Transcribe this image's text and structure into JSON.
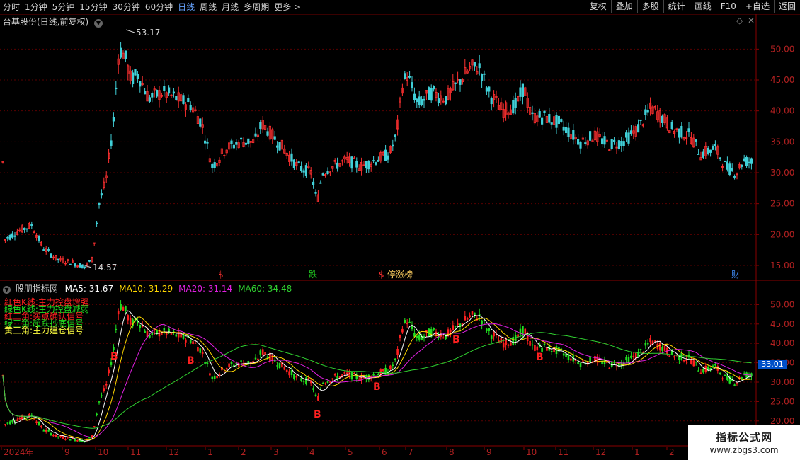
{
  "toolbar": {
    "periods": [
      "分时",
      "1分钟",
      "5分钟",
      "15分钟",
      "30分钟",
      "60分钟",
      "日线",
      "周线",
      "月线",
      "多周期",
      "更多 >"
    ],
    "active_period": "日线",
    "buttons": [
      "复权",
      "叠加",
      "多股",
      "统计",
      "画线",
      "F10",
      "+自选",
      "返回"
    ]
  },
  "top_chart": {
    "title": "台基股份(日线,前复权)",
    "y_ticks": [
      "50.00",
      "45.00",
      "40.00",
      "35.00",
      "30.00",
      "25.00",
      "20.00",
      "15.00"
    ],
    "high_label": "53.17",
    "low_label": "14.57",
    "events": [
      {
        "text": "$",
        "color": "#ff3030"
      },
      {
        "text": "跌",
        "color": "#20d020"
      },
      {
        "text": "$",
        "color": "#ff3030"
      },
      {
        "text": "停涨榜",
        "color": "#ffd060"
      },
      {
        "text": "财",
        "color": "#4090ff"
      }
    ],
    "colors": {
      "up": "#ff3030",
      "down": "#40d0d8"
    }
  },
  "bottom_chart": {
    "title": "股朋指标网",
    "ma": [
      {
        "label": "MA5: 31.67",
        "color": "#ffffff"
      },
      {
        "label": "MA10: 31.29",
        "color": "#ffd700"
      },
      {
        "label": "MA20: 31.14",
        "color": "#e020e0"
      },
      {
        "label": "MA60: 34.48",
        "color": "#30d030"
      }
    ],
    "legend": [
      {
        "text": "红色K线:主力控盘增强",
        "color": "#ff2020"
      },
      {
        "text": "绿色K线:主力控盘减弱",
        "color": "#20e020"
      },
      {
        "text": "红三角:买点确认信号",
        "color": "#ff2020"
      },
      {
        "text": "绿三角:超跌抄底信号",
        "color": "#20e020"
      },
      {
        "text": "黄三角:主力建仓信号",
        "color": "#ffff40"
      }
    ],
    "y_ticks": [
      "50.00",
      "45.00",
      "40.00",
      "35.00",
      "30.00",
      "25.00",
      "20.00"
    ],
    "current_price": "33.01",
    "signal_label": "B"
  },
  "x_axis": {
    "labels": [
      "2024年",
      "9",
      "10",
      "11",
      "12",
      "1",
      "2",
      "3",
      "4",
      "5",
      "6",
      "7",
      "8",
      "9",
      "10",
      "11",
      "12",
      "1",
      "2"
    ]
  },
  "watermark": {
    "title": "指标公式网",
    "url": "www.zbgs3.com"
  }
}
